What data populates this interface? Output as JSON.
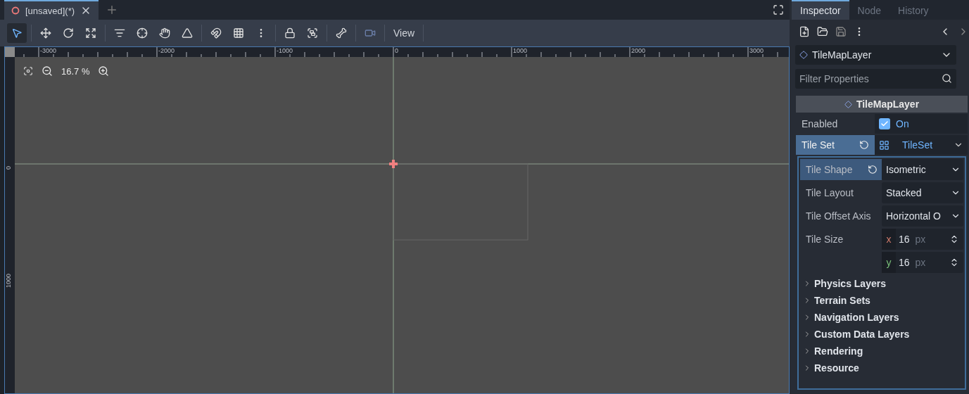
{
  "editor_tabs": [
    {
      "label": "[unsaved](*)",
      "selected": true
    }
  ],
  "toolbar": {
    "tools": [
      {
        "kind": "select",
        "selected": true
      },
      {
        "kind": "move",
        "selected": false
      },
      {
        "kind": "rotate",
        "selected": false
      },
      {
        "kind": "scale",
        "selected": false
      },
      {
        "kind": "list",
        "selected": false
      },
      {
        "kind": "pivot",
        "selected": false
      },
      {
        "kind": "pan",
        "selected": false
      },
      {
        "kind": "ruler",
        "selected": false
      },
      {
        "kind": "snap",
        "selected": false
      },
      {
        "kind": "grid",
        "selected": false
      },
      {
        "kind": "more",
        "selected": false
      },
      {
        "kind": "lock",
        "selected": false
      },
      {
        "kind": "group",
        "selected": false
      },
      {
        "kind": "bone",
        "selected": false
      },
      {
        "kind": "camera",
        "selected": false
      }
    ],
    "view_menu": "View"
  },
  "zoom": {
    "reading": "16.7 %"
  },
  "ruler": {
    "x_labels": [
      "-3000",
      "-2000",
      "-1000",
      "0",
      "1000",
      "2000",
      "3000"
    ],
    "y_labels": [
      "0",
      "1000"
    ]
  },
  "inspector": {
    "tabs": [
      {
        "label": "Inspector",
        "selected": true
      },
      {
        "label": "Node",
        "selected": false
      },
      {
        "label": "History",
        "selected": false
      }
    ],
    "node_type": "TileMapLayer",
    "filter_placeholder": "Filter Properties",
    "section_title": "TileMapLayer",
    "properties": [
      {
        "kind": "checkbox",
        "label": "Enabled",
        "checked": true,
        "value": "On"
      },
      {
        "kind": "resource",
        "label": "Tile Set",
        "value": "TileSet",
        "highlighted": true
      }
    ],
    "sub_properties": [
      {
        "kind": "dropdown",
        "label": "Tile Shape",
        "value": "Isometric",
        "highlighted": true
      },
      {
        "kind": "dropdown",
        "label": "Tile Layout",
        "value": "Stacked",
        "highlighted": false
      },
      {
        "kind": "dropdown",
        "label": "Tile Offset Axis",
        "value": "Horizontal O",
        "highlighted": false
      },
      {
        "kind": "vector",
        "label": "Tile Size",
        "highlighted": false,
        "components": [
          {
            "axis": "x",
            "value": "16",
            "unit": "px"
          },
          {
            "axis": "y",
            "value": "16",
            "unit": "px"
          }
        ]
      }
    ],
    "groups": [
      {
        "label": "Physics Layers",
        "expanded": false
      },
      {
        "label": "Terrain Sets",
        "expanded": false
      },
      {
        "label": "Navigation Layers",
        "expanded": false
      },
      {
        "label": "Custom Data Layers",
        "expanded": false
      },
      {
        "label": "Rendering",
        "expanded": false
      },
      {
        "label": "Resource",
        "expanded": false
      }
    ]
  }
}
